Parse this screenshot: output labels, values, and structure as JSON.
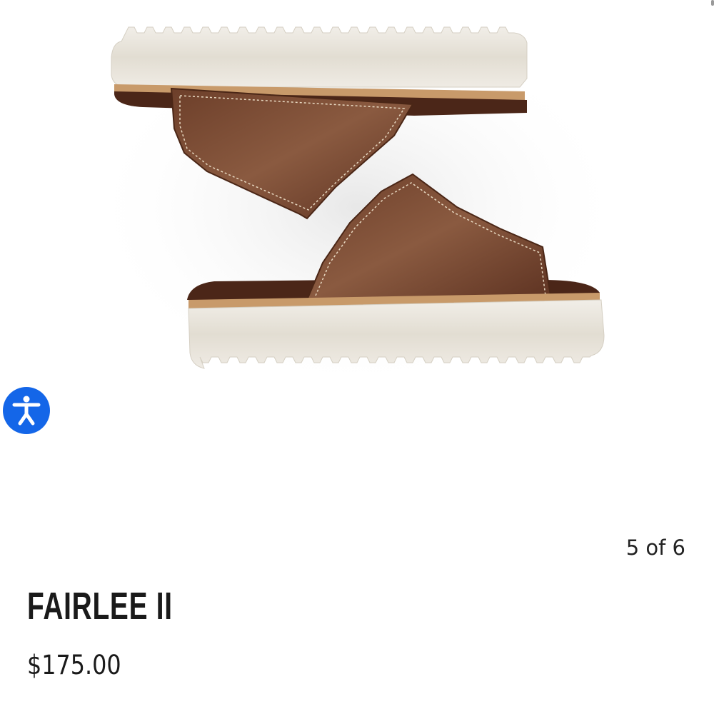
{
  "gallery": {
    "counter_text": "5 of 6"
  },
  "product": {
    "name": "FAIRLEE II",
    "price": "$175.00"
  },
  "accessibility": {
    "icon": "accessibility-person-icon",
    "color": "#1466e8"
  },
  "colors": {
    "leather": "#7a4a33",
    "sole": "#e7e2d8",
    "welt": "#c89a6a"
  }
}
